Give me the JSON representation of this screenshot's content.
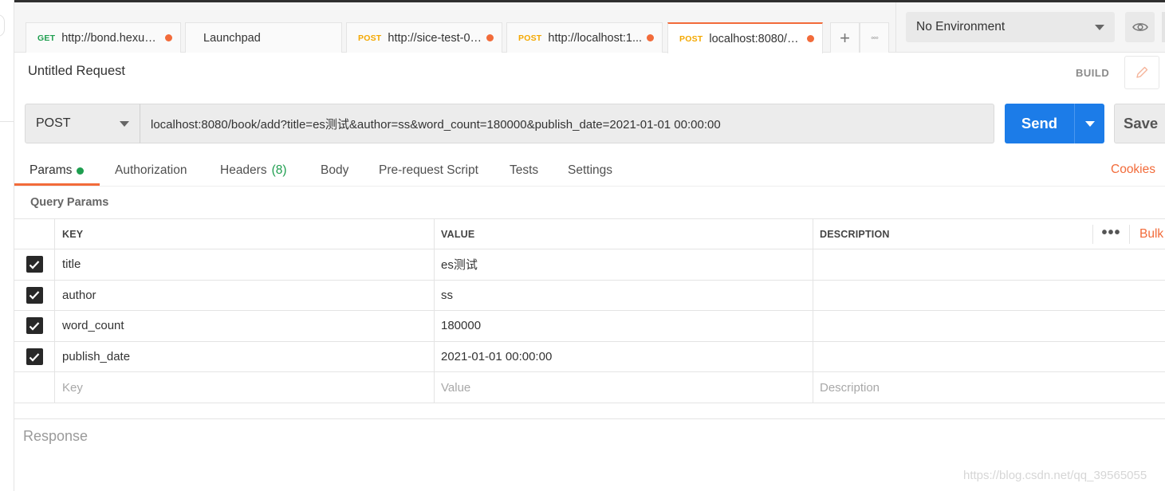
{
  "tabs": [
    {
      "method": "GET",
      "url": "http://bond.hexun....",
      "unsaved": true
    },
    {
      "method": "",
      "url": "Launchpad",
      "unsaved": false
    },
    {
      "method": "POST",
      "url": "http://sice-test-03....",
      "unsaved": true
    },
    {
      "method": "POST",
      "url": "http://localhost:1...",
      "unsaved": true
    },
    {
      "method": "POST",
      "url": "localhost:8080/bo...",
      "unsaved": true,
      "active": true
    }
  ],
  "tab_actions": {
    "new_tab": "+",
    "more": "◦◦◦"
  },
  "environment": {
    "selected": "No Environment"
  },
  "request": {
    "title": "Untitled Request",
    "build_label": "BUILD",
    "method": "POST",
    "url": "localhost:8080/book/add?title=es测试&author=ss&word_count=180000&publish_date=2021-01-01 00:00:00",
    "send_label": "Send",
    "save_label": "Save"
  },
  "subtabs": {
    "params": "Params",
    "authorization": "Authorization",
    "headers": "Headers",
    "headers_count": "(8)",
    "body": "Body",
    "prerequest": "Pre-request Script",
    "tests": "Tests",
    "settings": "Settings",
    "cookies": "Cookies"
  },
  "query_params": {
    "label": "Query Params",
    "columns": {
      "key": "KEY",
      "value": "VALUE",
      "description": "DESCRIPTION"
    },
    "more": "•••",
    "bulk_edit": "Bulk",
    "rows": [
      {
        "key": "title",
        "value": "es测试",
        "description": "",
        "checked": true
      },
      {
        "key": "author",
        "value": "ss",
        "description": "",
        "checked": true
      },
      {
        "key": "word_count",
        "value": "180000",
        "description": "",
        "checked": true
      },
      {
        "key": "publish_date",
        "value": "2021-01-01 00:00:00",
        "description": "",
        "checked": true
      }
    ],
    "placeholders": {
      "key": "Key",
      "value": "Value",
      "description": "Description"
    }
  },
  "response": {
    "label": "Response"
  },
  "watermark": "https://blog.csdn.net/qq_39565055",
  "colors": {
    "accent": "#f26b3a",
    "send": "#1c7ce8",
    "get": "#1e9e4f",
    "post": "#f4a800"
  }
}
